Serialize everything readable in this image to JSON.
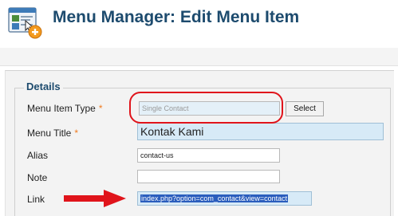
{
  "header": {
    "title": "Menu Manager: Edit Menu Item",
    "icon": "menu-manager-icon"
  },
  "details": {
    "legend": "Details",
    "menu_item_type": {
      "label": "Menu Item Type",
      "required_mark": "*",
      "value": "Single Contact",
      "select_label": "Select"
    },
    "menu_title": {
      "label": "Menu Title",
      "required_mark": "*",
      "value": "Kontak Kami"
    },
    "alias": {
      "label": "Alias",
      "value": "contact-us"
    },
    "note": {
      "label": "Note",
      "value": ""
    },
    "link": {
      "label": "Link",
      "value": "index.php?option=com_contact&view=contact"
    }
  },
  "annotations": {
    "highlight_color": "#e0141b",
    "arrow_color": "#e0141b"
  }
}
